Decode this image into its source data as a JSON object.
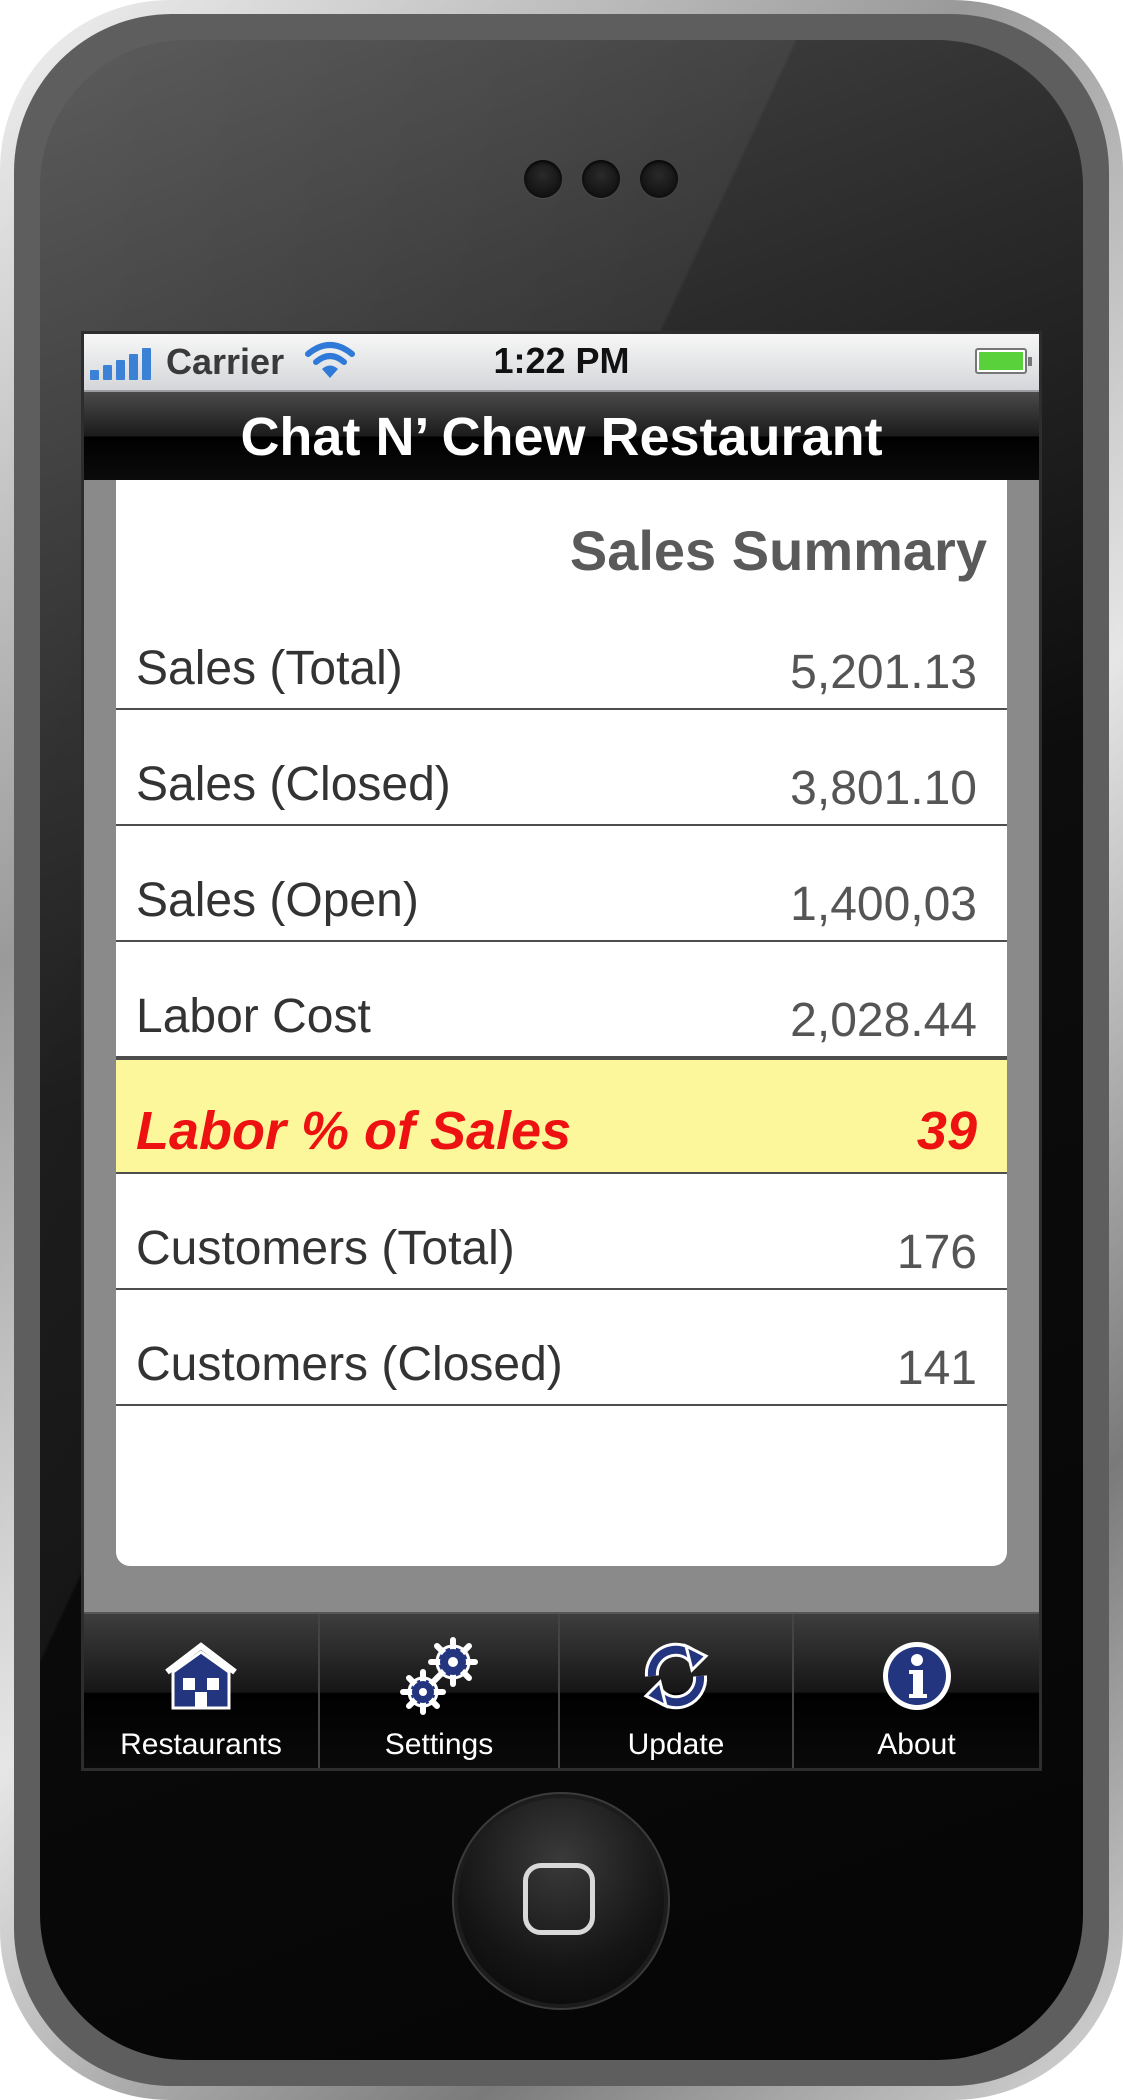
{
  "status_bar": {
    "carrier": "Carrier",
    "time": "1:22 PM"
  },
  "nav": {
    "title": "Chat N’ Chew Restaurant"
  },
  "summary": {
    "title": "Sales Summary",
    "rows": [
      {
        "label": "Sales (Total)",
        "value": "5,201.13"
      },
      {
        "label": "Sales (Closed)",
        "value": "3,801.10"
      },
      {
        "label": "Sales (Open)",
        "value": "1,400,03"
      },
      {
        "label": "Labor Cost",
        "value": "2,028.44"
      },
      {
        "label": "Labor % of Sales",
        "value": "39"
      },
      {
        "label": "Customers (Total)",
        "value": "176"
      },
      {
        "label": "Customers (Closed)",
        "value": "141"
      }
    ]
  },
  "tabs": [
    {
      "label": "Restaurants",
      "icon": "house-icon"
    },
    {
      "label": "Settings",
      "icon": "gears-icon"
    },
    {
      "label": "Update",
      "icon": "refresh-icon"
    },
    {
      "label": "About",
      "icon": "info-icon"
    }
  ],
  "colors": {
    "highlight_bg": "#fcf79a",
    "highlight_text": "#ee1111",
    "icon_blue": "#24357f"
  }
}
